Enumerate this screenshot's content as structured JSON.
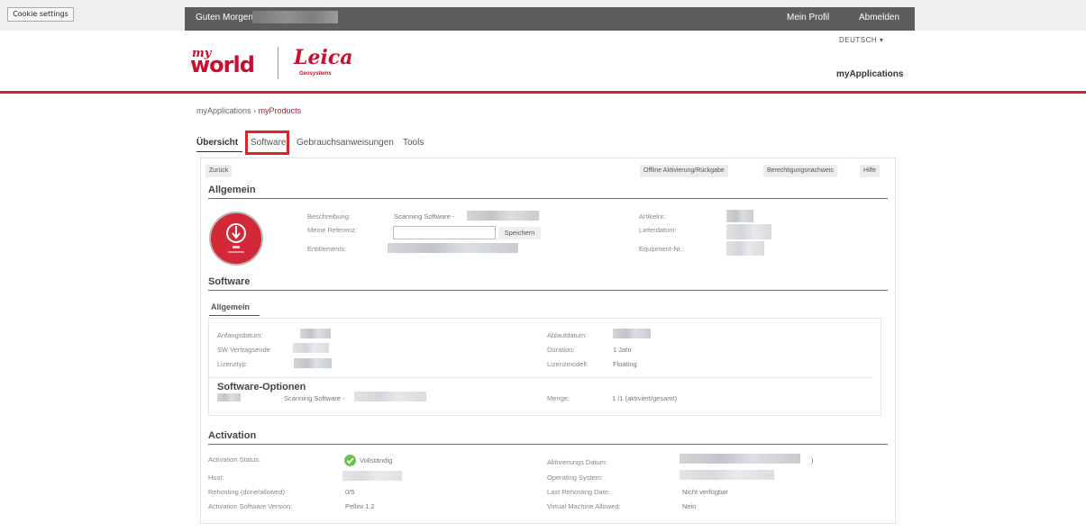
{
  "cookie_button": "Cookie settings",
  "header": {
    "greeting": "Guten Morgen",
    "profile_link": "Mein Profil",
    "logout_link": "Abmelden",
    "language": "DEUTSCH ▾",
    "app_title": "myApplications"
  },
  "logo": {
    "my": "my",
    "world": "world",
    "leica": "Leica",
    "geosystems": "Geosystems"
  },
  "breadcrumb": {
    "parent": "myApplications",
    "separator": "›",
    "current": "myProducts"
  },
  "tabs": [
    "Übersicht",
    "Software",
    "Gebrauchsanweisungen",
    "Tools"
  ],
  "toolbar": {
    "back": "Zurück",
    "offline": "Offline Aktivierung/Rückgabe",
    "entitlement": "Berechtigungsnachweis",
    "help": "Hilfe"
  },
  "general": {
    "title": "Allgemein",
    "description_label": "Beschreibung:",
    "description_value": "Scanning Software -",
    "reference_label": "Meine Referenz:",
    "save_label": "Speichern",
    "entitlements_label": "Entitlements:",
    "article_label": "Artikelnr.:",
    "delivery_label": "Lieferdatum:",
    "equipment_label": "Equipment-Nr.:",
    "reference_value": ""
  },
  "software": {
    "title": "Software",
    "subtab": "Allgemein",
    "start_label": "Anfangsdatum:",
    "contract_end_label": "SW Vertragsende:",
    "license_type_label": "Lizenztyp:",
    "expiry_label": "Ablaufdatum:",
    "duration_label": "Duration:",
    "duration_value": "1 Jahr",
    "license_model_label": "Lizenzmodell:",
    "license_model_value": "Floating",
    "options_title": "Software-Optionen",
    "option_name": "Scanning Software -",
    "quantity_label": "Menge:",
    "quantity_value": "1 /1  (aktiviert/gesamt)"
  },
  "activation": {
    "title": "Activation",
    "status_label": "Activation Status:",
    "status_value": "Vollständig",
    "host_label": "Host:",
    "rehosting_label": "Rehosting (done/allowed):",
    "rehosting_value": "0/5",
    "sw_version_label": "Activation Software Version:",
    "sw_version_value": "Pellini 1.2",
    "date_label": "Aktivierungs Datum:",
    "date_suffix": ")",
    "os_label": "Operating System:",
    "last_rehost_label": "Last Rehosting Date:",
    "last_rehost_value": "Nicht verfügbar",
    "vm_label": "Virtual Machine Allowed:",
    "vm_value": "Nein"
  },
  "colors": {
    "accent": "#c8102e",
    "topbar": "#5d5d5d",
    "highlight": "#d92727",
    "success": "#6cc24a"
  },
  "icons": {
    "software_icon": "download-disc-icon",
    "status_icon": "check-circle-icon"
  }
}
